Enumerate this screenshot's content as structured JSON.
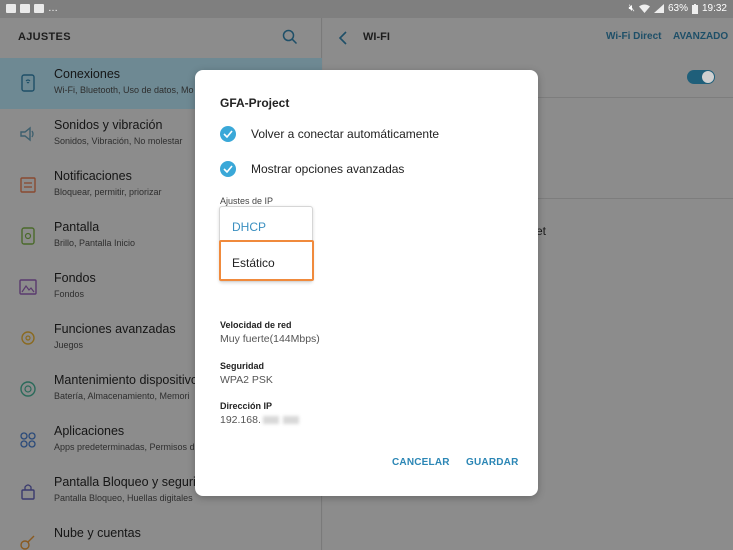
{
  "status_bar": {
    "battery": "63%",
    "time": "19:32"
  },
  "settings_pane": {
    "title": "AJUSTES",
    "items": [
      {
        "title": "Conexiones",
        "subtitle": "Wi-Fi, Bluetooth, Uso de datos, Mo"
      },
      {
        "title": "Sonidos y vibración",
        "subtitle": "Sonidos, Vibración, No molestar"
      },
      {
        "title": "Notificaciones",
        "subtitle": "Bloquear, permitir, priorizar"
      },
      {
        "title": "Pantalla",
        "subtitle": "Brillo, Pantalla Inicio"
      },
      {
        "title": "Fondos",
        "subtitle": "Fondos"
      },
      {
        "title": "Funciones avanzadas",
        "subtitle": "Juegos"
      },
      {
        "title": "Mantenimiento dispositivo",
        "subtitle": "Batería, Almacenamiento, Memori"
      },
      {
        "title": "Aplicaciones",
        "subtitle": "Apps predeterminadas, Permisos d"
      },
      {
        "title": "Pantalla Bloqueo y segurid",
        "subtitle": "Pantalla Bloqueo, Huellas digitales"
      },
      {
        "title": "Nube y cuentas",
        "subtitle": ""
      }
    ]
  },
  "wifi_pane": {
    "title": "WI-FI",
    "wifi_direct": "Wi-Fi Direct",
    "advanced": "AVANZADO",
    "fragment": "et"
  },
  "dialog": {
    "network_name": "GFA-Project",
    "auto_reconnect": "Volver a conectar automáticamente",
    "show_advanced": "Mostrar opciones avanzadas",
    "ip_settings_label": "Ajustes de IP",
    "ip_options": [
      "DHCP",
      "Estático"
    ],
    "network_speed_label": "Velocidad de red",
    "network_speed_value": "Muy fuerte(144Mbps)",
    "security_label": "Seguridad",
    "security_value": "WPA2 PSK",
    "ip_address_label": "Dirección IP",
    "ip_address_prefix": "192.168.",
    "cancel_label": "CANCELAR",
    "save_label": "GUARDAR"
  },
  "colors": {
    "accent": "#3aa8d8",
    "highlight_border": "#f08a3c",
    "button_text": "#2b86b5"
  }
}
